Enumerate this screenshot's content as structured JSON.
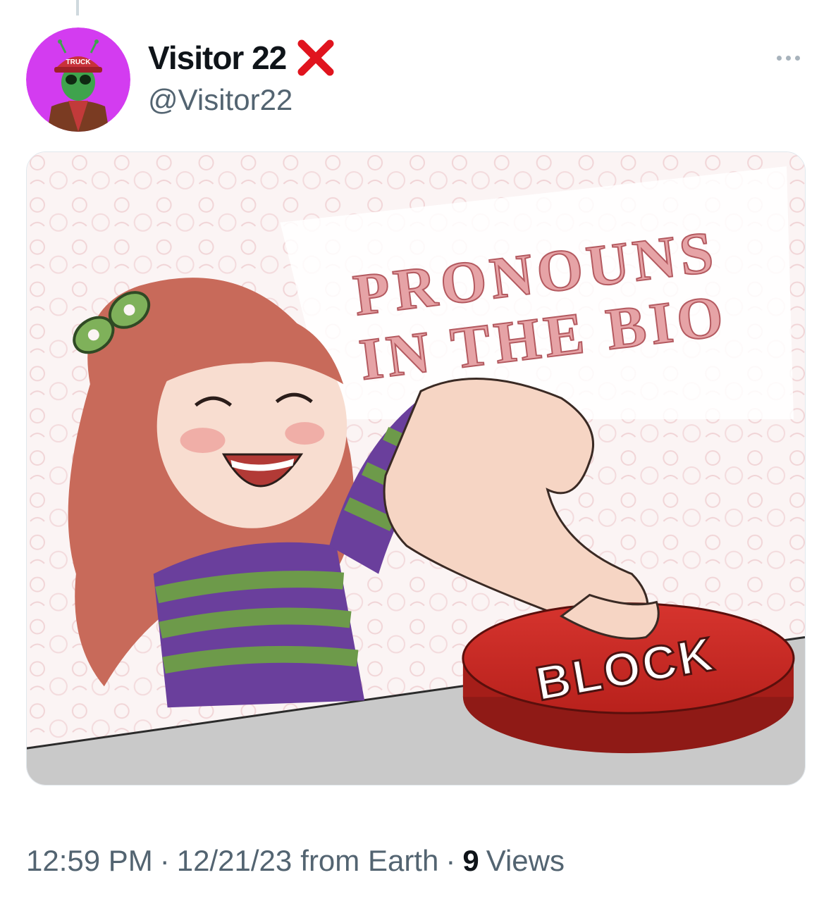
{
  "tweet": {
    "display_name": "Visitor 22",
    "handle": "@Visitor22",
    "badge_icon": "red-x-icon",
    "more_icon": "more-options-icon",
    "avatar_hat_text": "TRUCK",
    "media_text": {
      "line1": "PRONOUNS",
      "line2": "IN THE BIO",
      "button_label": "BLOCK"
    },
    "meta": {
      "time": "12:59 PM",
      "separator": "·",
      "date": "12/21/23",
      "source": "from Earth",
      "separator2": "·",
      "views_count": "9",
      "views_label": "Views"
    }
  },
  "colors": {
    "text_primary": "#0f1419",
    "text_secondary": "#536471",
    "badge_red": "#e0141e",
    "avatar_bg": "#d33cf0"
  }
}
